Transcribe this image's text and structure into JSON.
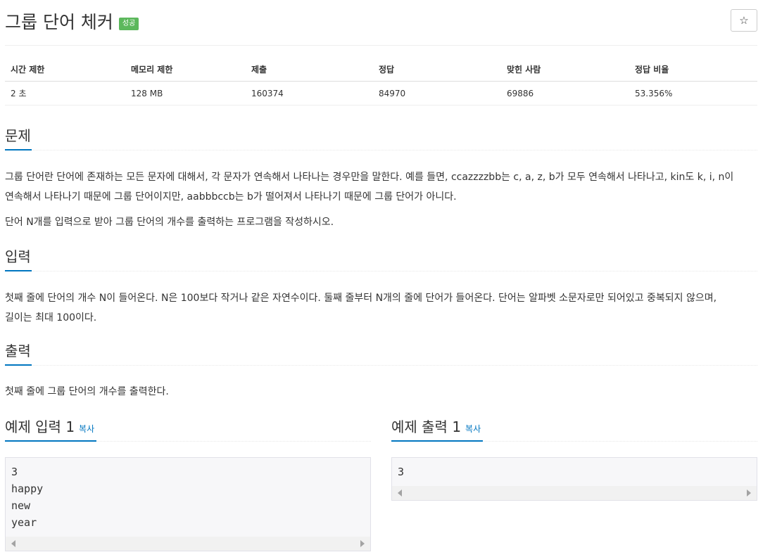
{
  "problem": {
    "title": "그룹 단어 체커",
    "badge": "성공",
    "star_icon": "☆"
  },
  "info_table": {
    "headers": [
      "시간 제한",
      "메모리 제한",
      "제출",
      "정답",
      "맞힌 사람",
      "정답 비율"
    ],
    "values": [
      "2 초",
      "128 MB",
      "160374",
      "84970",
      "69886",
      "53.356%"
    ]
  },
  "sections": {
    "problem": {
      "heading": "문제",
      "paragraph1_line1": "그룹 단어란 단어에 존재하는 모든 문자에 대해서, 각 문자가 연속해서 나타나는 경우만을 말한다. 예를 들면, ccazzzzbb는 c, a, z, b가 모두 연속해서 나타나고, kin도 k, i, n이",
      "paragraph1_line2": "연속해서 나타나기 때문에 그룹 단어이지만, aabbbccb는 b가 떨어져서 나타나기 때문에 그룹 단어가 아니다.",
      "paragraph2": "단어 N개를 입력으로 받아 그룹 단어의 개수를 출력하는 프로그램을 작성하시오."
    },
    "input": {
      "heading": "입력",
      "line1": "첫째 줄에 단어의 개수 N이 들어온다. N은 100보다 작거나 같은 자연수이다. 둘째 줄부터 N개의 줄에 단어가 들어온다. 단어는 알파벳 소문자로만 되어있고 중복되지 않으며,",
      "line2": "길이는 최대 100이다."
    },
    "output": {
      "heading": "출력",
      "text": "첫째 줄에 그룹 단어의 개수를 출력한다."
    }
  },
  "samples": {
    "input": {
      "heading": "예제 입력 1",
      "copy_label": "복사",
      "lines": [
        "3",
        "happy",
        "new",
        "year"
      ]
    },
    "output": {
      "heading": "예제 출력 1",
      "copy_label": "복사",
      "lines": [
        "3"
      ]
    }
  },
  "colors": {
    "accent": "#0076c0",
    "success_badge": "#5cb85c"
  }
}
